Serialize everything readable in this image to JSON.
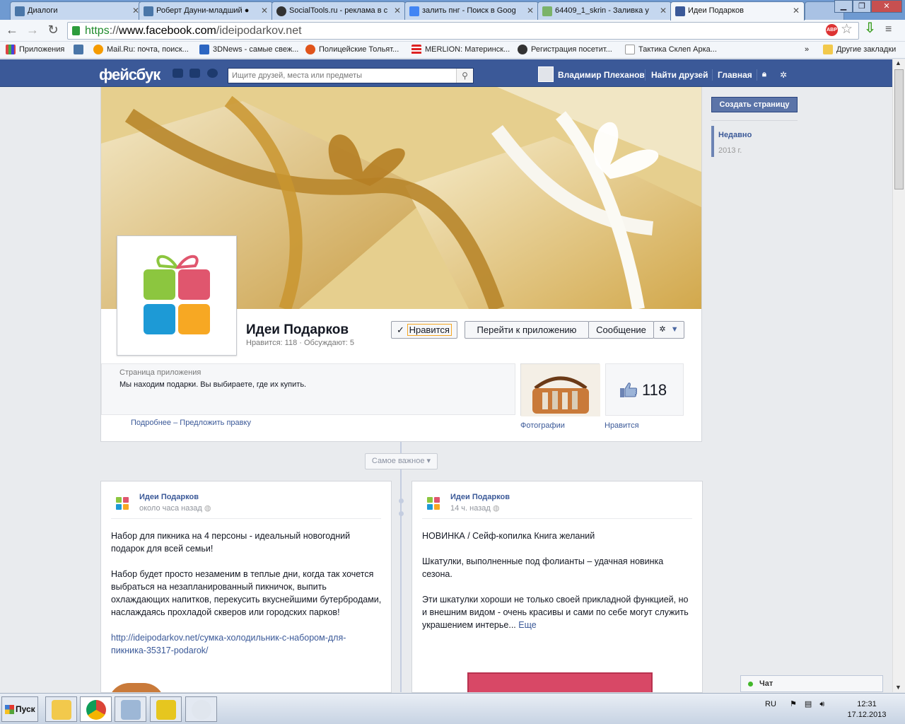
{
  "browser": {
    "tabs": [
      {
        "label": "Диалоги",
        "color": "#4a76a8"
      },
      {
        "label": "Роберт Дауни-младший ●",
        "color": "#4a76a8"
      },
      {
        "label": "SocialTools.ru - реклама в с",
        "color": "#333333"
      },
      {
        "label": "залить пнг - Поиск в Goog",
        "color": "#4285f4"
      },
      {
        "label": "64409_1_skrin - Заливка у",
        "color": "#7bb36a"
      },
      {
        "label": "Идеи Подарков",
        "color": "#3b5998"
      }
    ],
    "url_scheme": "https",
    "url_sep": "://",
    "url_host": "www.facebook.com",
    "url_path": "/ideipodarkov.net",
    "abp_label": "ABP",
    "bookmarks": [
      {
        "label": "Приложения",
        "icon": "apps-grid-icon"
      },
      {
        "label": "",
        "icon": "vk-icon"
      },
      {
        "label": "Mail.Ru: почта, поиск...",
        "icon": "mailru-icon"
      },
      {
        "label": "3DNews - самые свеж...",
        "icon": "3dnews-icon"
      },
      {
        "label": "Полицейские Тольят...",
        "icon": "police-icon"
      },
      {
        "label": "MERLION: Материнск...",
        "icon": "merlion-icon"
      },
      {
        "label": "Регистрация посетит...",
        "icon": "registration-icon"
      },
      {
        "label": "Тактика Склеп Арка...",
        "icon": "page-icon"
      }
    ],
    "bookmarks_more": "»",
    "other_bookmarks": "Другие закладки"
  },
  "fb_header": {
    "logo": "фейсбук",
    "search_placeholder": "Ищите друзей, места или предметы",
    "user_name": "Владимир Плеханов",
    "find_friends": "Найти друзей",
    "home": "Главная"
  },
  "sidebar": {
    "create_page": "Создать страницу",
    "recent_label": "Недавно",
    "recent_year": "2013 г."
  },
  "page": {
    "name": "Идеи Подарков",
    "stats": "Нравится: 118 · Обсуждают: 5",
    "like_button": "Нравится",
    "app_button": "Перейти к приложению",
    "message_button": "Сообщение",
    "category": "Страница приложения",
    "description": "Мы находим подарки. Вы выбираете, где их купить.",
    "more_link": "Подробнее",
    "suggest_link": "– Предложить правку",
    "photos_label": "Фотографии",
    "likes_count": "118",
    "likes_label": "Нравится",
    "filter_label": "Самое важное"
  },
  "posts": [
    {
      "author": "Идеи Подарков",
      "time": "около часа назад",
      "paragraphs": [
        "Набор для пикника на 4 персоны - идеальный новогодний подарок для всей семьи!",
        "Набор будет просто незаменим в теплые дни, когда так хочется выбраться на незапланированный пикничок, выпить охлаждающих напитков, перекусить вкуснейшими бутербродами, наслаждаясь прохладой скверов или городских парков!"
      ],
      "link": "http://ideipodarkov.net/сумка-холодильник-с-набором-для-пикника-35317-podarok/"
    },
    {
      "author": "Идеи Подарков",
      "time": "14 ч. назад",
      "paragraphs": [
        "НОВИНКА / Сейф-копилка Книга желаний",
        "Шкатулки, выполненные под фолианты – удачная новинка сезона."
      ],
      "last_paragraph": "Эти шкатулки хороши не только своей прикладной функцией, но и внешним видом - очень красивы и сами по себе могут служить украшением интерье...",
      "more": "Еще"
    }
  ],
  "chat": {
    "label": "Чат"
  },
  "taskbar": {
    "start": "Пуск",
    "lang": "RU",
    "time": "12:31",
    "date": "17.12.2013"
  },
  "colors": {
    "fb_blue": "#3b5998",
    "gift_green": "#8cc63f",
    "gift_pink": "#e0566e",
    "gift_blue": "#1d9ad6",
    "gift_orange": "#f7a823"
  }
}
